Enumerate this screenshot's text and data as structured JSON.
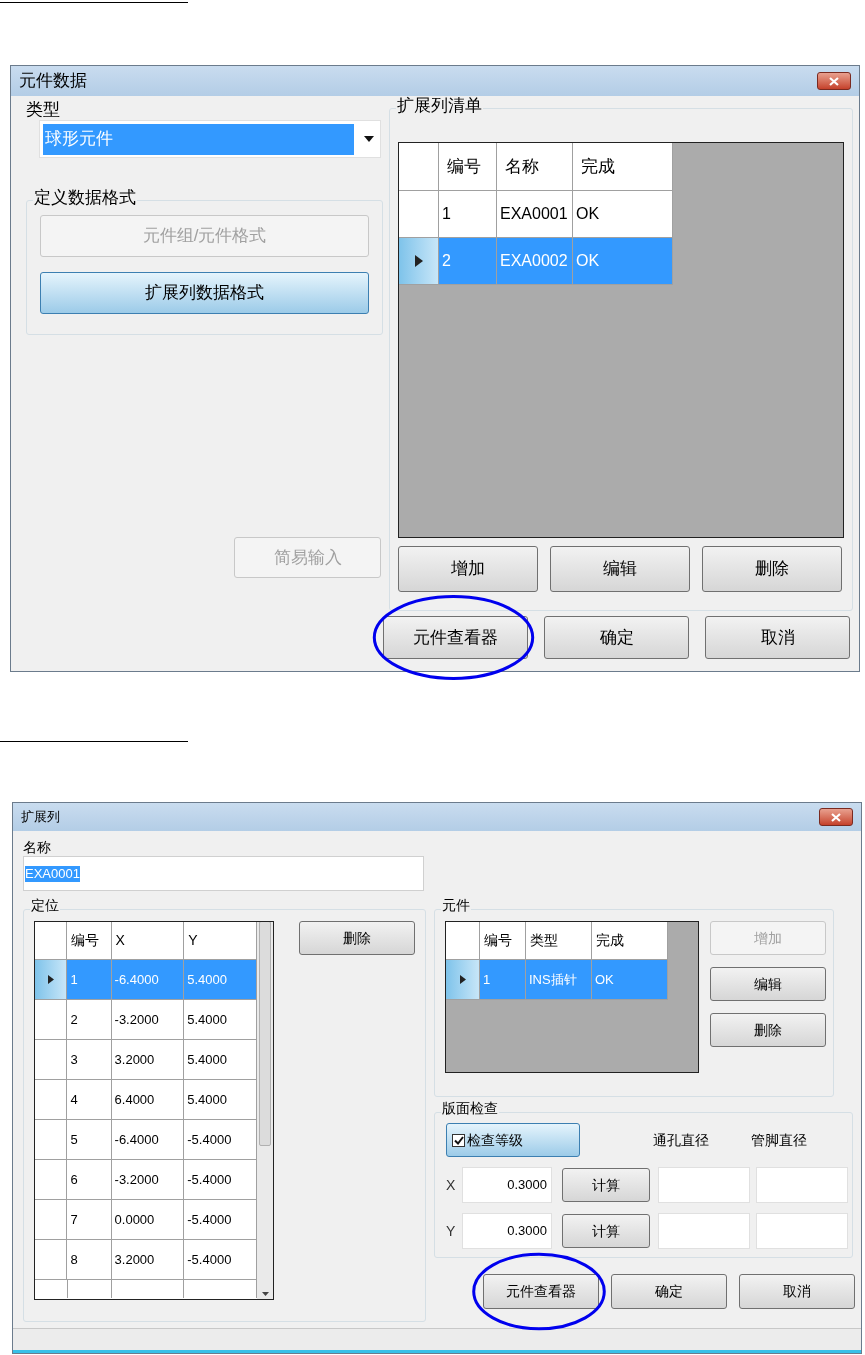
{
  "dialog_1": {
    "title": "元件数据",
    "type_label": "类型",
    "type_combo": {
      "value": "球形元件",
      "selected": true
    },
    "format_group": {
      "title": "定义数据格式",
      "buttons": [
        {
          "label": "元件组/元件格式",
          "disabled": true,
          "selected": false
        },
        {
          "label": "扩展列数据格式",
          "disabled": false,
          "selected": true
        }
      ]
    },
    "simple_input_button": {
      "label": "简易输入",
      "disabled": true
    },
    "list_group": {
      "title": "扩展列清单",
      "columns": [
        "编号",
        "名称",
        "完成"
      ],
      "rows": [
        {
          "cells": [
            "1",
            "EXA0001",
            "OK"
          ],
          "selected": false
        },
        {
          "cells": [
            "2",
            "EXA0002",
            "OK"
          ],
          "selected": true
        }
      ],
      "buttons": [
        "增加",
        "编辑",
        "删除"
      ]
    },
    "footer_buttons": [
      {
        "label": "元件查看器",
        "highlighted": true
      },
      {
        "label": "确定",
        "highlighted": false
      },
      {
        "label": "取消",
        "highlighted": false
      }
    ]
  },
  "dialog_2": {
    "title": "扩展列",
    "name_label": "名称",
    "name_field": {
      "value": "EXA0001",
      "selected": true
    },
    "position_group": {
      "title": "定位",
      "columns": [
        "编号",
        "X",
        "Y"
      ],
      "rows": [
        {
          "cells": [
            "1",
            "-6.4000",
            "5.4000"
          ],
          "selected": true
        },
        {
          "cells": [
            "2",
            "-3.2000",
            "5.4000"
          ],
          "selected": false
        },
        {
          "cells": [
            "3",
            "3.2000",
            "5.4000"
          ],
          "selected": false
        },
        {
          "cells": [
            "4",
            "6.4000",
            "5.4000"
          ],
          "selected": false
        },
        {
          "cells": [
            "5",
            "-6.4000",
            "-5.4000"
          ],
          "selected": false
        },
        {
          "cells": [
            "6",
            "-3.2000",
            "-5.4000"
          ],
          "selected": false
        },
        {
          "cells": [
            "7",
            "0.0000",
            "-5.4000"
          ],
          "selected": false
        },
        {
          "cells": [
            "8",
            "3.2000",
            "-5.4000"
          ],
          "selected": false
        }
      ],
      "delete_button": "删除"
    },
    "parts_group": {
      "title": "元件",
      "columns": [
        "编号",
        "类型",
        "完成"
      ],
      "rows": [
        {
          "cells": [
            "1",
            "INS插针",
            "OK"
          ],
          "selected": true
        }
      ],
      "buttons": [
        {
          "label": "增加",
          "disabled": true
        },
        {
          "label": "编辑",
          "disabled": false
        },
        {
          "label": "删除",
          "disabled": false
        }
      ]
    },
    "check_group": {
      "title": "版面检查",
      "check_level": {
        "label": "检查等级",
        "checked": true
      },
      "headers": [
        "通孔直径",
        "管脚直径"
      ],
      "rows": [
        {
          "axis": "X",
          "value": "0.3000",
          "button": "计算"
        },
        {
          "axis": "Y",
          "value": "0.3000",
          "button": "计算"
        }
      ]
    },
    "footer_buttons": [
      {
        "label": "元件查看器",
        "highlighted": true
      },
      {
        "label": "确定",
        "highlighted": false
      },
      {
        "label": "取消",
        "highlighted": false
      }
    ]
  }
}
